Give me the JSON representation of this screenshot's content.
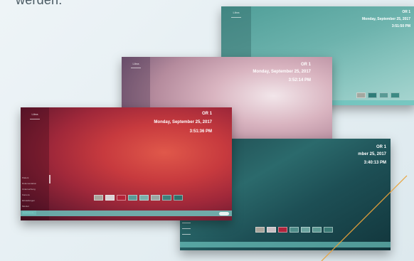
{
  "caption": "werden.",
  "screens": {
    "teal": {
      "logo": "Libra",
      "room": "OR 1",
      "date": "Monday, September 25, 2017",
      "time": "3:51:50 PM"
    },
    "rose": {
      "logo": "Libra",
      "room": "OR 1",
      "date": "Monday, September 25, 2017",
      "time": "3:52:14 PM"
    },
    "red": {
      "logo": "Libra",
      "room": "OR 1",
      "date": "Monday, September 25, 2017",
      "time": "3:51:36 PM",
      "menu": [
        "Patient",
        "Dokumentation",
        "Untersuchung",
        "Kamera",
        "Einstellungen",
        "Monitor",
        "Dokumente"
      ]
    },
    "dark": {
      "room": "OR 1",
      "date": "mber 25, 2017",
      "time": "3:40:13 PM"
    }
  },
  "colors": {
    "teal_bg": "#5aa6a0",
    "accent_line": "#e8a23a",
    "bar": "#6cc3bd"
  }
}
